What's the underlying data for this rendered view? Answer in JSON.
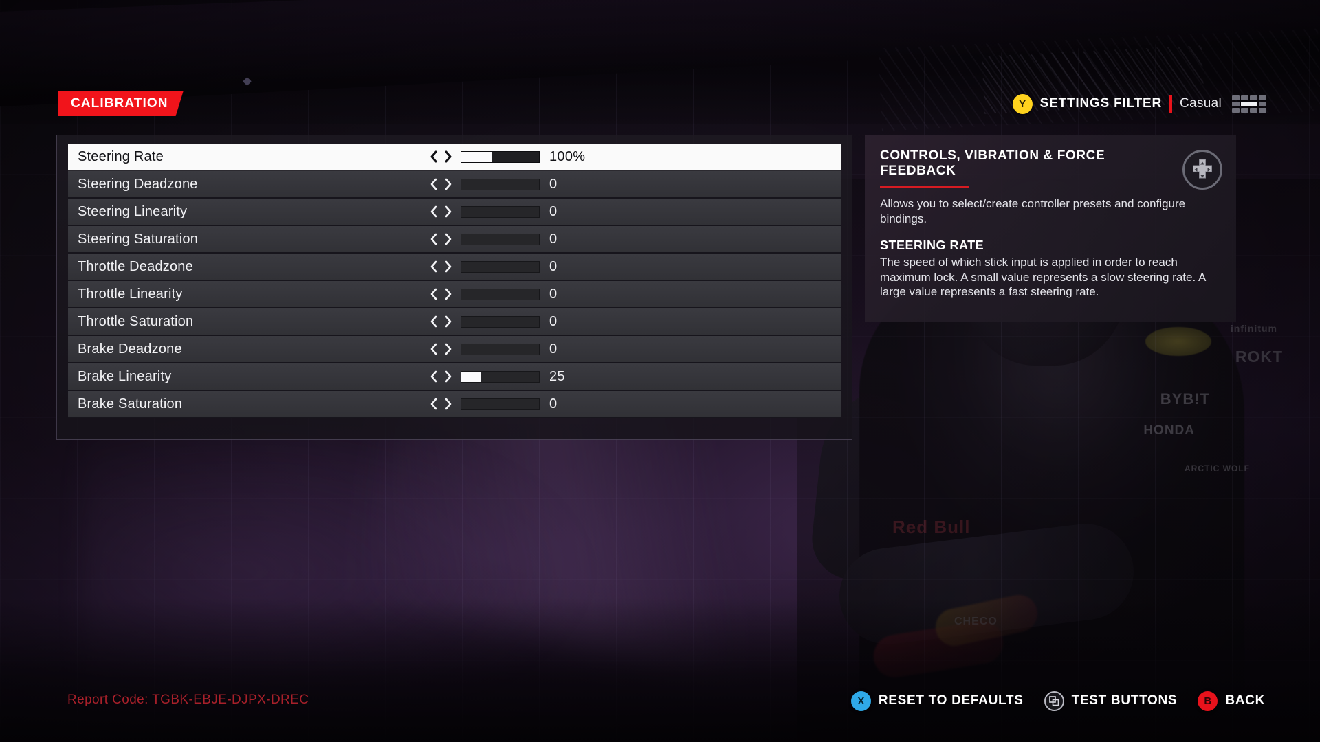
{
  "header": {
    "tab_label": "CALIBRATION",
    "filter_button_glyph": "Y",
    "filter_label": "SETTINGS FILTER",
    "filter_value": "Casual",
    "keyboard_icon": "keyboard-icon"
  },
  "settings": {
    "rows": [
      {
        "label": "Steering Rate",
        "value": "100%",
        "fill_pct": 40,
        "selected": true
      },
      {
        "label": "Steering Deadzone",
        "value": "0",
        "fill_pct": 0,
        "selected": false
      },
      {
        "label": "Steering Linearity",
        "value": "0",
        "fill_pct": 0,
        "selected": false
      },
      {
        "label": "Steering Saturation",
        "value": "0",
        "fill_pct": 0,
        "selected": false
      },
      {
        "label": "Throttle Deadzone",
        "value": "0",
        "fill_pct": 0,
        "selected": false
      },
      {
        "label": "Throttle Linearity",
        "value": "0",
        "fill_pct": 0,
        "selected": false
      },
      {
        "label": "Throttle Saturation",
        "value": "0",
        "fill_pct": 0,
        "selected": false
      },
      {
        "label": "Brake Deadzone",
        "value": "0",
        "fill_pct": 0,
        "selected": false
      },
      {
        "label": "Brake Linearity",
        "value": "25",
        "fill_pct": 25,
        "selected": false
      },
      {
        "label": "Brake Saturation",
        "value": "0",
        "fill_pct": 0,
        "selected": false
      }
    ]
  },
  "info": {
    "heading": "CONTROLS, VIBRATION & FORCE FEEDBACK",
    "body": "Allows you to select/create controller presets and configure bindings.",
    "sub_heading": "STEERING RATE",
    "sub_body": "The speed of which stick input is applied in order to reach maximum lock. A small value represents a slow steering rate. A large value represents a fast steering rate.",
    "dpad_icon": "dpad-icon"
  },
  "footer": {
    "report_code": "Report Code: TGBK-EBJE-DJPX-DREC",
    "prompts": [
      {
        "glyph": "X",
        "label": "RESET TO DEFAULTS",
        "style": "btn-x"
      },
      {
        "glyph": "",
        "label": "TEST BUTTONS",
        "style": "btn-win"
      },
      {
        "glyph": "B",
        "label": "BACK",
        "style": "btn-b"
      }
    ]
  },
  "colors": {
    "accent_red": "#e8131b",
    "tab_red": "#f1141b",
    "button_y": "#ffd21e",
    "button_x": "#2fa9e8",
    "button_b": "#e8121c",
    "report_code": "#a8202a"
  },
  "background": {
    "suit_text": [
      "BYB!T",
      "HONDA",
      "ROKT",
      "infinitum",
      "Red Bull",
      "CHECO",
      "ARCTIC WOLF"
    ]
  }
}
